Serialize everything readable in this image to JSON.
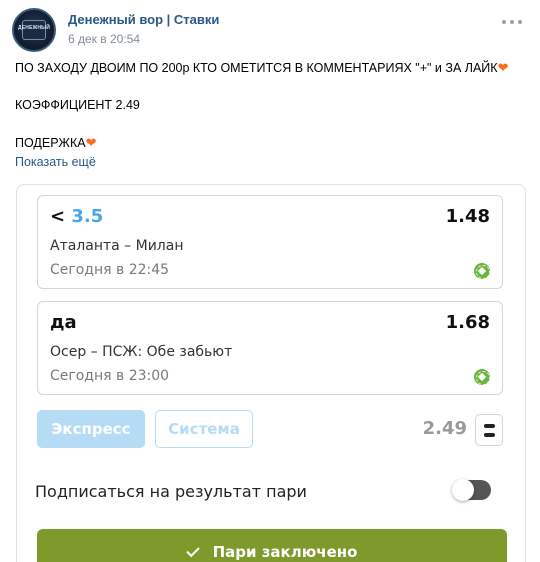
{
  "post": {
    "author": "Денежный вор | Ставки",
    "date": "6 дек в 20:54",
    "avatar_text": "ДЕНЕЖНЫЙ",
    "lines": [
      "ПО ЗАХОДУ ДВОИМ ПО 200р КТО ОМЕТИТСЯ В КОММЕНТАРИЯХ \"+\" и ЗА ЛАЙК",
      "КОЭФФИЦИЕНТ 2.49",
      "ПОДЕРЖКА"
    ],
    "heart": "❤",
    "show_more": "Показать ещё"
  },
  "bets": [
    {
      "pick_prefix": "<",
      "pick_value": "3.5",
      "odds": "1.48",
      "match": "Аталанта – Милан",
      "time": "Сегодня в 22:45"
    },
    {
      "pick_prefix": "да",
      "pick_value": "",
      "odds": "1.68",
      "match": "Осер – ПСЖ: Обе забьют",
      "time": "Сегодня в 23:00"
    }
  ],
  "modes": {
    "express": "Экспресс",
    "system": "Система",
    "selected": "Экспресс"
  },
  "total_odds": "2.49",
  "subscribe": {
    "label": "Подписаться на результат пари",
    "enabled": false
  },
  "confirm_label": "Пари заключено",
  "colors": {
    "accent_blue": "#4aa6e8",
    "confirm_green": "#7d9a2a",
    "link": "#2a5885"
  }
}
